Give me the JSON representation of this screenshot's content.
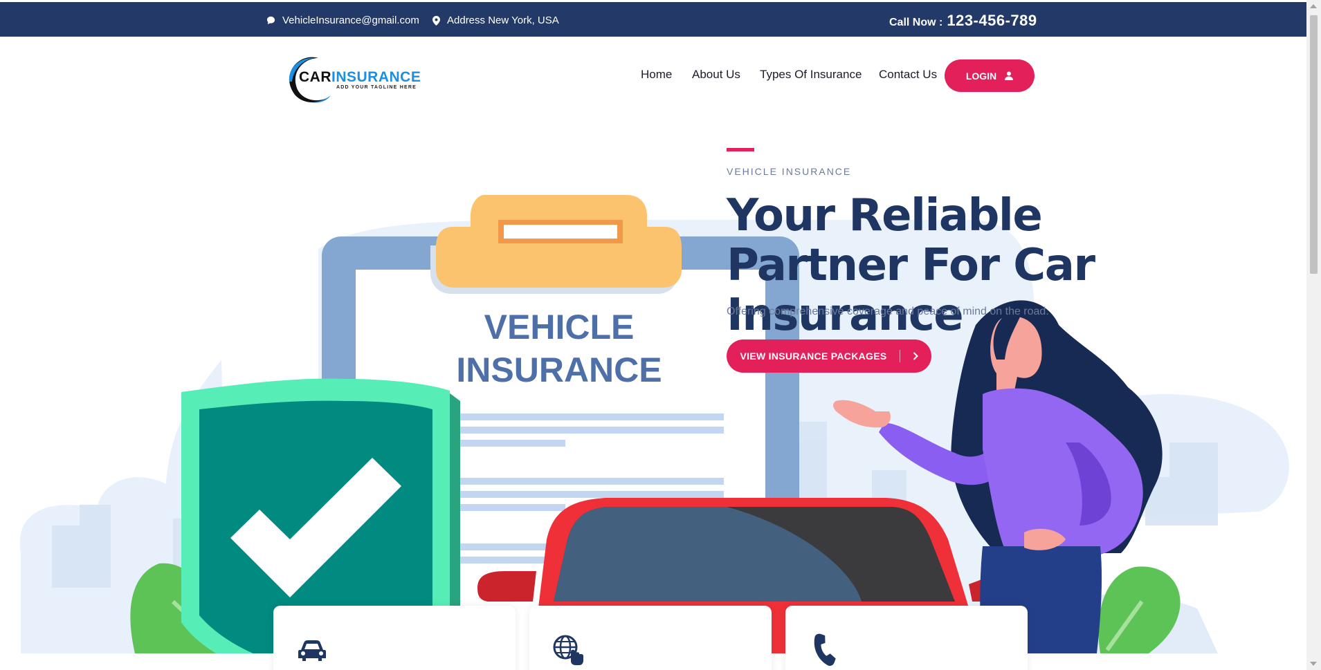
{
  "topbar": {
    "email": "VehicleInsurance@gmail.com",
    "address": "Address New York, USA",
    "call_label": "Call Now :",
    "phone": "123-456-789",
    "email_icon": "chat-bubble-icon",
    "address_icon": "map-pin-icon"
  },
  "logo": {
    "brand_car": "CAR",
    "brand_insurance": "INSURANCE",
    "tagline": "ADD YOUR TAGLINE HERE"
  },
  "nav": {
    "items": [
      "Home",
      "About Us",
      "Types Of Insurance",
      "Contact Us"
    ],
    "login_label": "LOGIN",
    "login_icon": "user-icon"
  },
  "hero": {
    "eyebrow": "VEHICLE INSURANCE",
    "headline": "Your Reliable Partner For Car Insurance",
    "subtext": "Offering comprehensive coverage and peace of mind on the road.",
    "cta_label": "VIEW INSURANCE PACKAGES",
    "cta_icon": "chevron-right-icon",
    "clipboard_line1": "VEHICLE",
    "clipboard_line2": "INSURANCE"
  },
  "cards": [
    {
      "icon": "car-icon"
    },
    {
      "icon": "globe-touch-icon"
    },
    {
      "icon": "phone-icon"
    }
  ],
  "colors": {
    "topbar": "#233a68",
    "accent": "#e3205a",
    "headline": "#1f3663",
    "muted": "#6b7a99"
  }
}
